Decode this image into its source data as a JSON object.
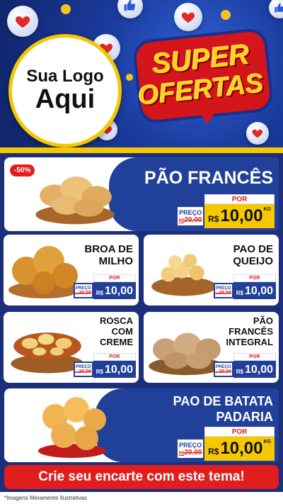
{
  "hero": {
    "logo_line1": "Sua Logo",
    "logo_line2": "Aqui",
    "super_line1": "SUPER",
    "super_line2": "OFERTAS"
  },
  "products": [
    {
      "name_lines": [
        "PÃO FRANCÊS"
      ],
      "badge": "-50%",
      "price_label": "PREÇO",
      "old_price": "20,00",
      "old_prefix": "R$",
      "por": "POR",
      "currency": "R$",
      "new_price": "10,00",
      "unit": "KG"
    },
    {
      "name_lines": [
        "BROA DE",
        "MILHO"
      ],
      "price_label": "PREÇO",
      "old_price": "20,00",
      "old_prefix": "R$",
      "por": "POR",
      "currency": "R$",
      "new_price": "10,00"
    },
    {
      "name_lines": [
        "PAO DE",
        "QUEIJO"
      ],
      "price_label": "PREÇO",
      "old_price": "20,00",
      "old_prefix": "R$",
      "por": "POR",
      "currency": "R$",
      "new_price": "10,00"
    },
    {
      "name_lines": [
        "ROSCA",
        "COM",
        "CREME"
      ],
      "price_label": "PREÇO",
      "old_price": "20,00",
      "old_prefix": "R$",
      "por": "POR",
      "currency": "R$",
      "new_price": "10,00"
    },
    {
      "name_lines": [
        "PÃO",
        "FRANCÊS",
        "INTEGRAL"
      ],
      "price_label": "PREÇO",
      "old_price": "20,00",
      "old_prefix": "R$",
      "por": "POR",
      "currency": "R$",
      "new_price": "10,00"
    },
    {
      "name_lines": [
        "PAO DE BATATA",
        "PADARIA"
      ],
      "price_label": "PREÇO",
      "old_price": "20,00",
      "old_prefix": "R$",
      "por": "POR",
      "currency": "R$",
      "new_price": "10,00",
      "unit": "KG"
    }
  ],
  "cta": "Crie seu encarte com este tema!",
  "footnote": "*Imagens Meramente Ilustrativas",
  "colors": {
    "brand_blue": "#21409a",
    "accent_red": "#e21d1d",
    "accent_yellow": "#f6c800"
  },
  "icons": [
    "heart-icon",
    "like-icon"
  ]
}
